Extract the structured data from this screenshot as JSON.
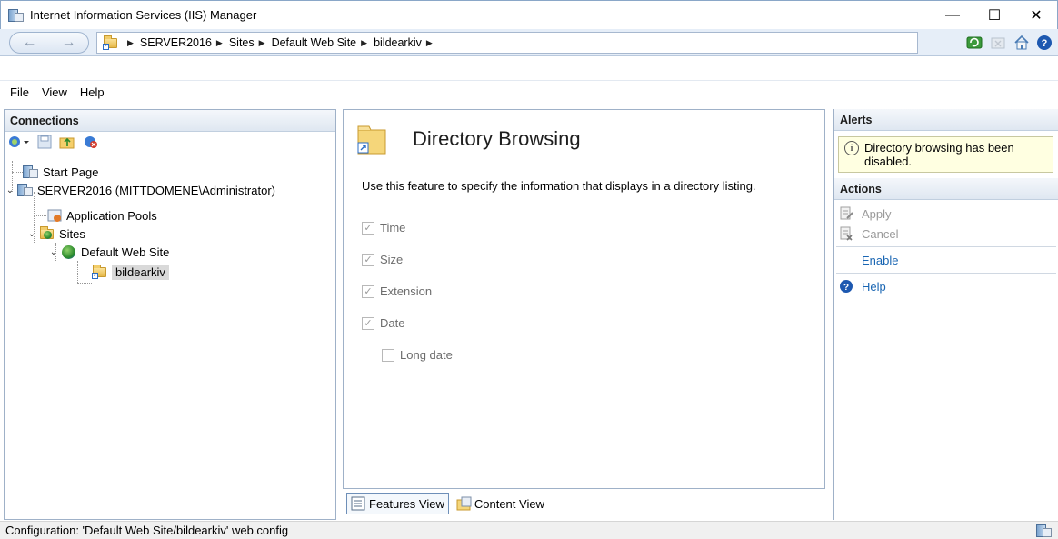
{
  "window": {
    "title": "Internet Information Services (IIS) Manager",
    "minimize": "—",
    "maximize": "☐",
    "close": "✕"
  },
  "address": {
    "back": "←",
    "forward": "→",
    "crumbs": [
      "SERVER2016",
      "Sites",
      "Default Web Site",
      "bildearkiv"
    ]
  },
  "menu": {
    "items": [
      "File",
      "View",
      "Help"
    ]
  },
  "connections": {
    "header": "Connections",
    "tree": [
      {
        "label": "Start Page"
      },
      {
        "label": "SERVER2016 (MITTDOMENE\\Administrator)"
      },
      {
        "label": "Application Pools"
      },
      {
        "label": "Sites"
      },
      {
        "label": "Default Web Site"
      },
      {
        "label": "bildearkiv"
      }
    ]
  },
  "feature": {
    "title": "Directory Browsing",
    "description": "Use this feature to specify the information that displays in a directory listing.",
    "options": [
      {
        "label": "Time",
        "checked": true
      },
      {
        "label": "Size",
        "checked": true
      },
      {
        "label": "Extension",
        "checked": true
      },
      {
        "label": "Date",
        "checked": true
      },
      {
        "label": "Long date",
        "checked": false
      }
    ]
  },
  "views": {
    "features": "Features View",
    "content": "Content View"
  },
  "alerts": {
    "header": "Alerts",
    "message": "Directory browsing has been disabled."
  },
  "actions": {
    "header": "Actions",
    "apply": "Apply",
    "cancel": "Cancel",
    "enable": "Enable",
    "help": "Help"
  },
  "status": {
    "text": "Configuration: 'Default Web Site/bildearkiv' web.config"
  },
  "colors": {
    "link": "#1a66b3",
    "alert_bg": "#ffffe1",
    "header_bg": "#dfe7f1"
  }
}
